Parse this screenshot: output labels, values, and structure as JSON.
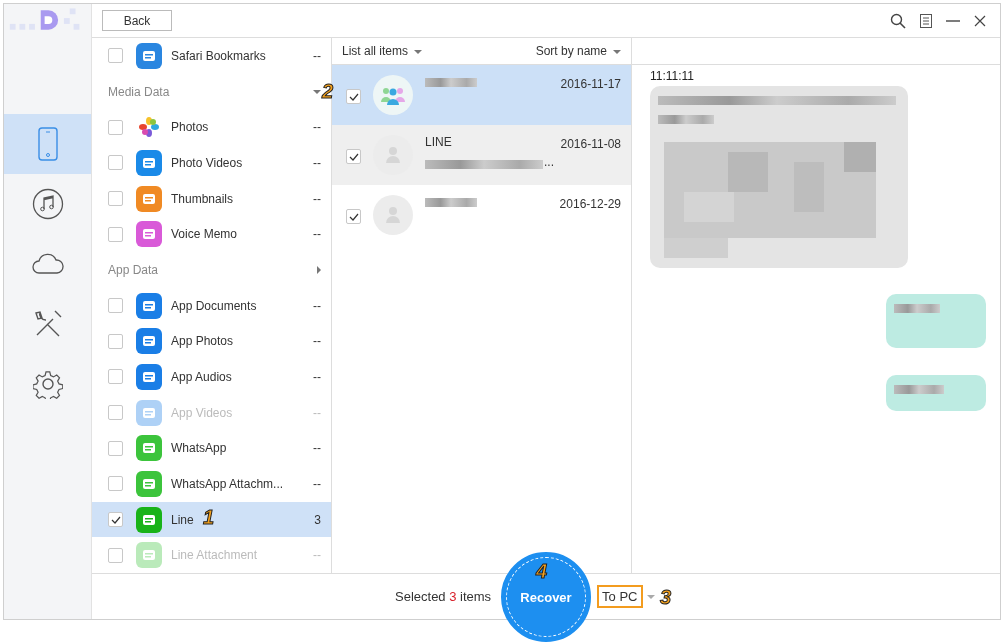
{
  "toolbar": {
    "back": "Back"
  },
  "nav": [
    {
      "selected": true
    },
    {
      "selected": false
    },
    {
      "selected": false
    },
    {
      "selected": false
    },
    {
      "selected": false
    }
  ],
  "categories": [
    {
      "kind": "item",
      "label": "Safari Bookmarks",
      "count": "--",
      "checked": false,
      "disabled": false,
      "selected": false
    },
    {
      "kind": "header",
      "label": "Media Data",
      "expanded": true
    },
    {
      "kind": "item",
      "label": "Photos",
      "count": "--",
      "checked": false,
      "disabled": false,
      "selected": false
    },
    {
      "kind": "item",
      "label": "Photo Videos",
      "count": "--",
      "checked": false,
      "disabled": false,
      "selected": false
    },
    {
      "kind": "item",
      "label": "Thumbnails",
      "count": "--",
      "checked": false,
      "disabled": false,
      "selected": false
    },
    {
      "kind": "item",
      "label": "Voice Memo",
      "count": "--",
      "checked": false,
      "disabled": false,
      "selected": false
    },
    {
      "kind": "header",
      "label": "App Data",
      "expanded": false
    },
    {
      "kind": "item",
      "label": "App Documents",
      "count": "--",
      "checked": false,
      "disabled": false,
      "selected": false
    },
    {
      "kind": "item",
      "label": "App Photos",
      "count": "--",
      "checked": false,
      "disabled": false,
      "selected": false
    },
    {
      "kind": "item",
      "label": "App Audios",
      "count": "--",
      "checked": false,
      "disabled": false,
      "selected": false
    },
    {
      "kind": "item",
      "label": "App Videos",
      "count": "--",
      "checked": false,
      "disabled": true,
      "selected": false
    },
    {
      "kind": "item",
      "label": "WhatsApp",
      "count": "--",
      "checked": false,
      "disabled": false,
      "selected": false
    },
    {
      "kind": "item",
      "label": "WhatsApp Attachm...",
      "count": "--",
      "checked": false,
      "disabled": false,
      "selected": false
    },
    {
      "kind": "item",
      "label": "Line",
      "count": "3",
      "checked": true,
      "disabled": false,
      "selected": true
    },
    {
      "kind": "item",
      "label": "Line Attachment",
      "count": "--",
      "checked": false,
      "disabled": true,
      "selected": false
    }
  ],
  "list_header": {
    "filter": "List all items",
    "sort": "Sort by name"
  },
  "conversations": [
    {
      "date": "2016-11-17",
      "checked": true,
      "selected": true,
      "hovered": false
    },
    {
      "name": "LINE",
      "preview_end": "...",
      "date": "2016-11-08",
      "checked": true,
      "selected": false,
      "hovered": true
    },
    {
      "date": "2016-12-29",
      "checked": true,
      "selected": false,
      "hovered": false
    }
  ],
  "chat": {
    "time": "11:11:11",
    "messages": [
      {
        "kind": "incoming"
      },
      {
        "kind": "outgoing"
      },
      {
        "kind": "outgoing"
      }
    ]
  },
  "footer": {
    "prefix": "Selected",
    "count": "3",
    "suffix": "items",
    "recover": "Recover",
    "target": "To PC"
  },
  "callouts": [
    {
      "label": "1"
    },
    {
      "label": "2"
    },
    {
      "label": "3"
    },
    {
      "label": "4"
    }
  ]
}
